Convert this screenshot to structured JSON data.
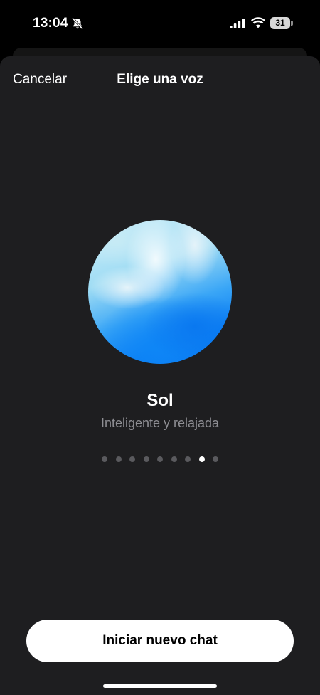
{
  "status_bar": {
    "time": "13:04",
    "battery": "31",
    "icons": [
      "bell-slash-icon",
      "cellular-signal-icon",
      "wifi-icon",
      "battery-icon"
    ]
  },
  "sheet": {
    "cancel_label": "Cancelar",
    "title": "Elige una voz"
  },
  "voice": {
    "name": "Sol",
    "description": "Inteligente y relajada",
    "orb_colors": [
      "#cfeff8",
      "#9fdcf4",
      "#3aa6f6",
      "#0b7ef4"
    ]
  },
  "pagination": {
    "total": 9,
    "current": 8
  },
  "actions": {
    "start_chat_label": "Iniciar nuevo chat"
  },
  "colors": {
    "background": "#1e1e20",
    "secondary_text": "#8e8e93",
    "dot_inactive": "#5a5a5e",
    "dot_active": "#ffffff"
  }
}
